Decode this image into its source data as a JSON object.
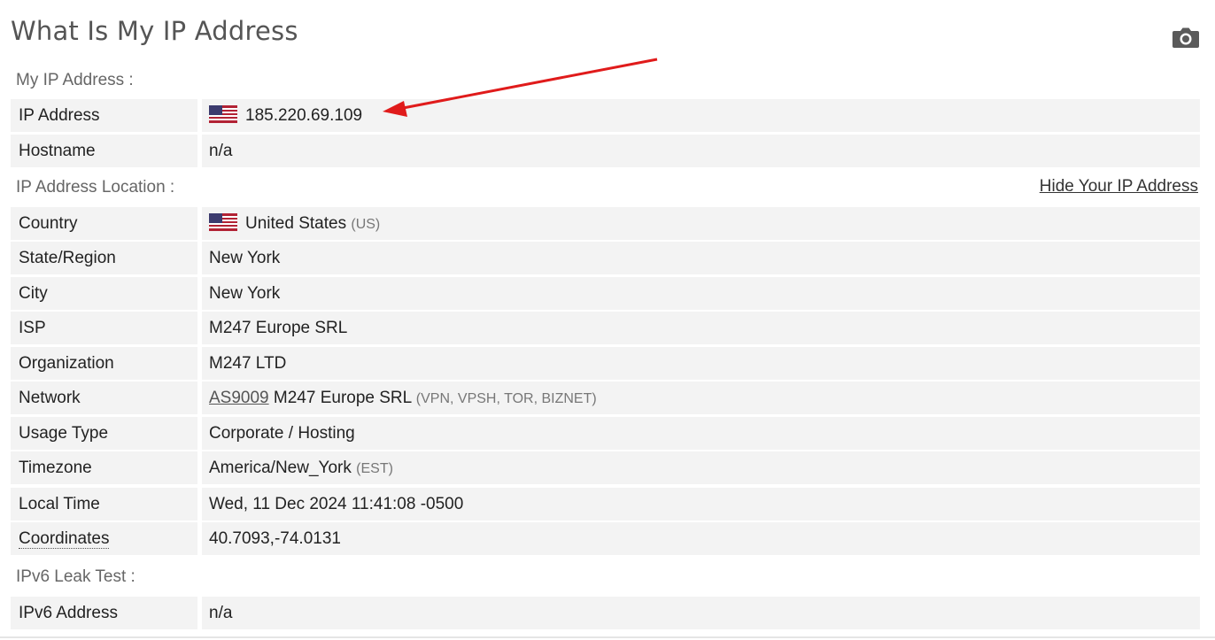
{
  "page": {
    "title": "What Is My IP Address"
  },
  "sections": {
    "my_ip": "My IP Address :",
    "location": "IP Address Location :",
    "ipv6": "IPv6 Leak Test :"
  },
  "hide_link": "Hide Your IP Address",
  "rows": {
    "ip_address": {
      "label": "IP Address",
      "value": "185.220.69.109"
    },
    "hostname": {
      "label": "Hostname",
      "value": "n/a"
    },
    "country": {
      "label": "Country",
      "value": "United States",
      "code": "(US)"
    },
    "state": {
      "label": "State/Region",
      "value": "New York"
    },
    "city": {
      "label": "City",
      "value": "New York"
    },
    "isp": {
      "label": "ISP",
      "value": "M247 Europe SRL"
    },
    "organization": {
      "label": "Organization",
      "value": "M247 LTD"
    },
    "network": {
      "label": "Network",
      "asn": "AS9009",
      "value": "M247 Europe SRL",
      "tags": "(VPN, VPSH, TOR, BIZNET)"
    },
    "usage_type": {
      "label": "Usage Type",
      "value": "Corporate / Hosting"
    },
    "timezone": {
      "label": "Timezone",
      "value": "America/New_York",
      "abbr": "(EST)"
    },
    "local_time": {
      "label": "Local Time",
      "value": "Wed, 11 Dec 2024 11:41:08 -0500"
    },
    "coordinates": {
      "label": "Coordinates",
      "value": "40.7093,-74.0131"
    },
    "ipv6_address": {
      "label": "IPv6 Address",
      "value": "n/a"
    }
  },
  "icons": {
    "camera": "camera-icon",
    "flag": "us-flag-icon",
    "arrow": "red-arrow-annotation"
  },
  "colors": {
    "arrow": "#e01b1b",
    "row_bg": "#f3f3f3",
    "title": "#555555"
  }
}
